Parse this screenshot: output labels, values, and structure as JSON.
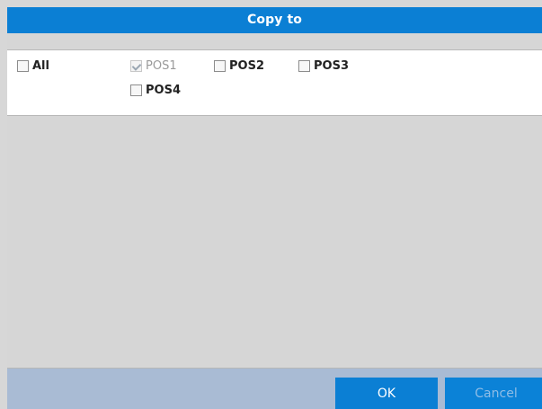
{
  "dialog": {
    "title": "Copy to"
  },
  "options": {
    "all": "All",
    "pos1": "POS1",
    "pos2": "POS2",
    "pos3": "POS3",
    "pos4": "POS4"
  },
  "states": {
    "all": false,
    "pos1": true,
    "pos2": false,
    "pos3": false,
    "pos4": false
  },
  "buttons": {
    "ok": "OK",
    "cancel": "Cancel"
  },
  "colors": {
    "title_bar": "#0b7fd4",
    "panel": "#ffffff",
    "background": "#d6d6d6",
    "footer": "#a9bbd4",
    "button": "#0b7fd4"
  }
}
